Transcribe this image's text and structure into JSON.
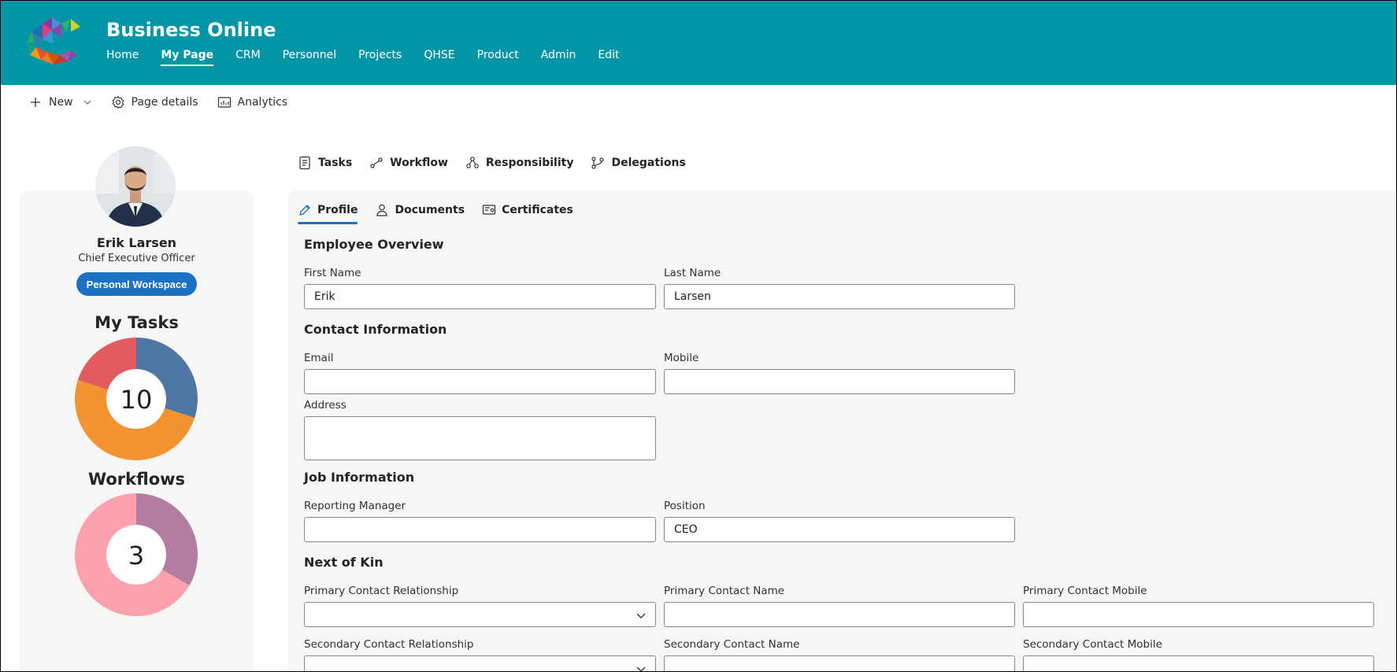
{
  "site": {
    "title": "Business Online"
  },
  "topnav": [
    {
      "label": "Home",
      "active": false
    },
    {
      "label": "My Page",
      "active": true
    },
    {
      "label": "CRM",
      "active": false
    },
    {
      "label": "Personnel",
      "active": false
    },
    {
      "label": "Projects",
      "active": false
    },
    {
      "label": "QHSE",
      "active": false
    },
    {
      "label": "Product",
      "active": false
    },
    {
      "label": "Admin",
      "active": false
    },
    {
      "label": "Edit",
      "active": false
    }
  ],
  "commandbar": {
    "new": "New",
    "page_details": "Page details",
    "analytics": "Analytics"
  },
  "profile": {
    "name": "Erik Larsen",
    "title": "Chief Executive Officer",
    "workspace_button": "Personal Workspace"
  },
  "widgets": {
    "tasks": {
      "title": "My Tasks",
      "total": "10",
      "segments": [
        {
          "value": 3,
          "color": "#4f77a6"
        },
        {
          "value": 5,
          "color": "#f39431"
        },
        {
          "value": 2,
          "color": "#e35b5e"
        }
      ]
    },
    "workflows": {
      "title": "Workflows",
      "total": "3",
      "segments": [
        {
          "value": 1,
          "color": "#b27ca3"
        },
        {
          "value": 2,
          "color": "#fea1ad"
        }
      ]
    }
  },
  "toptabs": {
    "tasks": "Tasks",
    "workflow": "Workflow",
    "responsibility": "Responsibility",
    "delegations": "Delegations"
  },
  "subtabs": {
    "profile": "Profile",
    "documents": "Documents",
    "certificates": "Certificates"
  },
  "form": {
    "employee_overview": {
      "heading": "Employee Overview",
      "first_name_label": "First Name",
      "first_name": "Erik",
      "last_name_label": "Last Name",
      "last_name": "Larsen"
    },
    "contact": {
      "heading": "Contact Information",
      "email_label": "Email",
      "email": "",
      "mobile_label": "Mobile",
      "mobile": "",
      "address_label": "Address",
      "address": ""
    },
    "job": {
      "heading": "Job Information",
      "manager_label": "Reporting Manager",
      "manager": "",
      "position_label": "Position",
      "position": "CEO"
    },
    "kin": {
      "heading": "Next of Kin",
      "primary_relationship_label": "Primary Contact Relationship",
      "primary_name_label": "Primary Contact Name",
      "primary_mobile_label": "Primary Contact Mobile",
      "secondary_relationship_label": "Secondary Contact Relationship",
      "secondary_name_label": "Secondary Contact Name",
      "secondary_mobile_label": "Secondary Contact Mobile"
    }
  }
}
